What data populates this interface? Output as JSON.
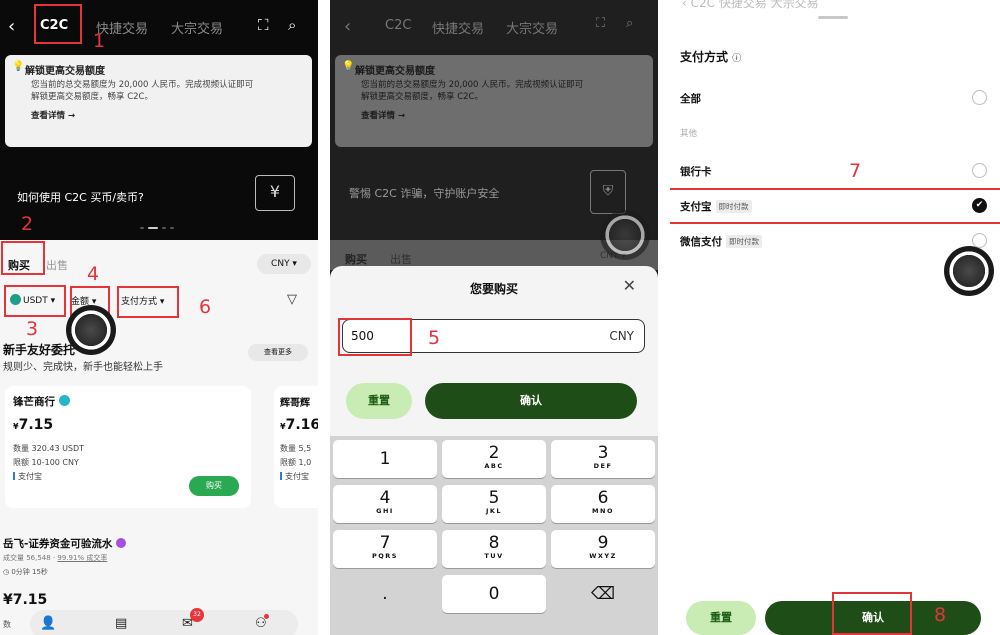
{
  "panel1": {
    "nav": {
      "back": "‹",
      "tab_c2c": "C2C",
      "tab_quick": "快捷交易",
      "tab_bulk": "大宗交易"
    },
    "notice": {
      "title": "解锁更高交易额度",
      "desc_line1": "您当前的总交易额度为 20,000 人民币。完成视频认证即可",
      "desc_line2": "解锁更高交易额度，畅享 C2C。",
      "link": "查看详情 →"
    },
    "banner": {
      "title": "如何使用 C2C 买币/卖币?"
    },
    "trade_tabs": {
      "buy": "购买",
      "sell": "出售"
    },
    "currency": "CNY ▾",
    "filters": {
      "coin": "USDT ▾",
      "amount": "金额 ▾",
      "payment": "支付方式 ▾"
    },
    "section": {
      "title": "新手友好委托",
      "subtitle": "规则少、完成快，新手也能轻松上手",
      "see_more": "查看更多"
    },
    "merchant1": {
      "name": "锋芒商行",
      "currency_symbol": "¥",
      "price": "7.15",
      "qty": "数量 320.43 USDT",
      "limit": "限额 10-100 CNY",
      "pay": "支付宝",
      "buy": "购买"
    },
    "merchant2": {
      "name": "辉哥辉",
      "currency_symbol": "¥",
      "price": "7.16",
      "qty": "数量 5,5",
      "limit": "限额 1,0",
      "pay": "支付宝"
    },
    "merchant3": {
      "name": "岳飞-证券资金可验流水",
      "stats_prefix": "成交量 56,548 · ",
      "stats_rate": "99.91% 成交率",
      "time": "0分钟 15秒",
      "price": "¥7.15",
      "cut": "数"
    },
    "bottom_nav": {
      "badge": "32"
    },
    "annotations": {
      "n1": "1",
      "n2": "2",
      "n3": "3",
      "n4": "4",
      "n6": "6"
    }
  },
  "panel2": {
    "nav": {
      "back": "‹",
      "tab_c2c": "C2C",
      "tab_quick": "快捷交易",
      "tab_bulk": "大宗交易"
    },
    "notice": {
      "title": "解锁更高交易额度",
      "desc_line1": "您当前的总交易额度为 20,000 人民币。完成视频认证即可",
      "desc_line2": "解锁更高交易额度，畅享 C2C。",
      "link": "查看详情 →"
    },
    "banner": {
      "title": "警惕 C2C 诈骗，守护账户安全"
    },
    "trade_tabs": {
      "buy": "购买",
      "sell": "出售",
      "currency": "CNY ▾"
    },
    "sheet": {
      "title": "您要购买",
      "amount_value": "500",
      "amount_unit": "CNY",
      "reset": "重置",
      "confirm": "确认"
    },
    "keypad": [
      {
        "digit": "1",
        "letters": ""
      },
      {
        "digit": "2",
        "letters": "ABC"
      },
      {
        "digit": "3",
        "letters": "DEF"
      },
      {
        "digit": "4",
        "letters": "GHI"
      },
      {
        "digit": "5",
        "letters": "JKL"
      },
      {
        "digit": "6",
        "letters": "MNO"
      },
      {
        "digit": "7",
        "letters": "PQRS"
      },
      {
        "digit": "8",
        "letters": "TUV"
      },
      {
        "digit": "9",
        "letters": "WXYZ"
      },
      {
        "digit": ".",
        "letters": ""
      },
      {
        "digit": "0",
        "letters": ""
      }
    ],
    "annotations": {
      "n5": "5"
    }
  },
  "panel3": {
    "ghost_nav": "‹ C2C 快捷交易 大宗交易",
    "title": "支付方式",
    "all": "全部",
    "other_header": "其他",
    "options": [
      {
        "label": "银行卡",
        "tag": ""
      },
      {
        "label": "支付宝",
        "tag": "即时付款"
      },
      {
        "label": "微信支付",
        "tag": "即时付款"
      }
    ],
    "reset": "重置",
    "confirm": "确认",
    "annotations": {
      "n7": "7",
      "n8": "8"
    }
  }
}
